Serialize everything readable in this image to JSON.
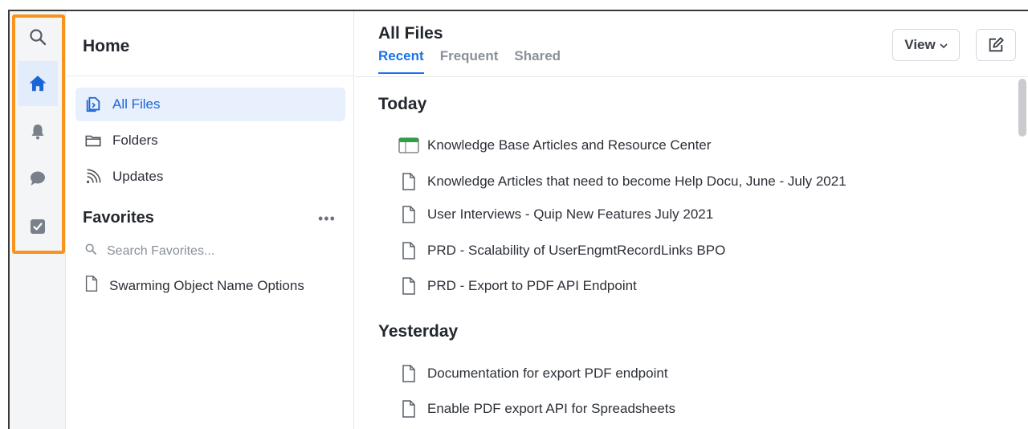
{
  "rail": {
    "items": [
      {
        "icon": "search-icon"
      },
      {
        "icon": "home-icon",
        "active": true
      },
      {
        "icon": "bell-icon"
      },
      {
        "icon": "chat-bubble-icon"
      },
      {
        "icon": "checkbox-icon"
      }
    ],
    "highlight_color": "#f7941d"
  },
  "home": {
    "title": "Home",
    "nav": [
      {
        "label": "All Files",
        "icon": "all-files-icon",
        "active": true
      },
      {
        "label": "Folders",
        "icon": "folder-icon"
      },
      {
        "label": "Updates",
        "icon": "updates-icon"
      }
    ],
    "favorites": {
      "title": "Favorites",
      "more": "•••",
      "search_placeholder": "Search Favorites...",
      "items": [
        {
          "label": "Swarming Object Name Options",
          "icon": "document-icon"
        }
      ]
    }
  },
  "main": {
    "title": "All Files",
    "tabs": [
      {
        "label": "Recent",
        "active": true
      },
      {
        "label": "Frequent"
      },
      {
        "label": "Shared"
      }
    ],
    "view_label": "View",
    "sections": [
      {
        "title": "Today",
        "files": [
          {
            "name": "Knowledge Base Articles and Resource Center",
            "icon": "spreadsheet-icon"
          },
          {
            "name": "Knowledge Articles that need to become Help Docu, June - July 2021",
            "icon": "document-icon"
          },
          {
            "name": "User Interviews - Quip New Features July 2021",
            "icon": "document-icon"
          },
          {
            "name": "PRD - Scalability of UserEngmtRecordLinks BPO",
            "icon": "document-icon"
          },
          {
            "name": "PRD - Export to PDF API Endpoint",
            "icon": "document-icon"
          }
        ]
      },
      {
        "title": "Yesterday",
        "files": [
          {
            "name": "Documentation for export PDF endpoint",
            "icon": "document-icon"
          },
          {
            "name": "Enable PDF export API for Spreadsheets",
            "icon": "document-icon"
          }
        ]
      }
    ]
  },
  "colors": {
    "accent": "#1a73e8",
    "active_bg": "#e8f0fd",
    "spreadsheet_green": "#2e9e47"
  }
}
